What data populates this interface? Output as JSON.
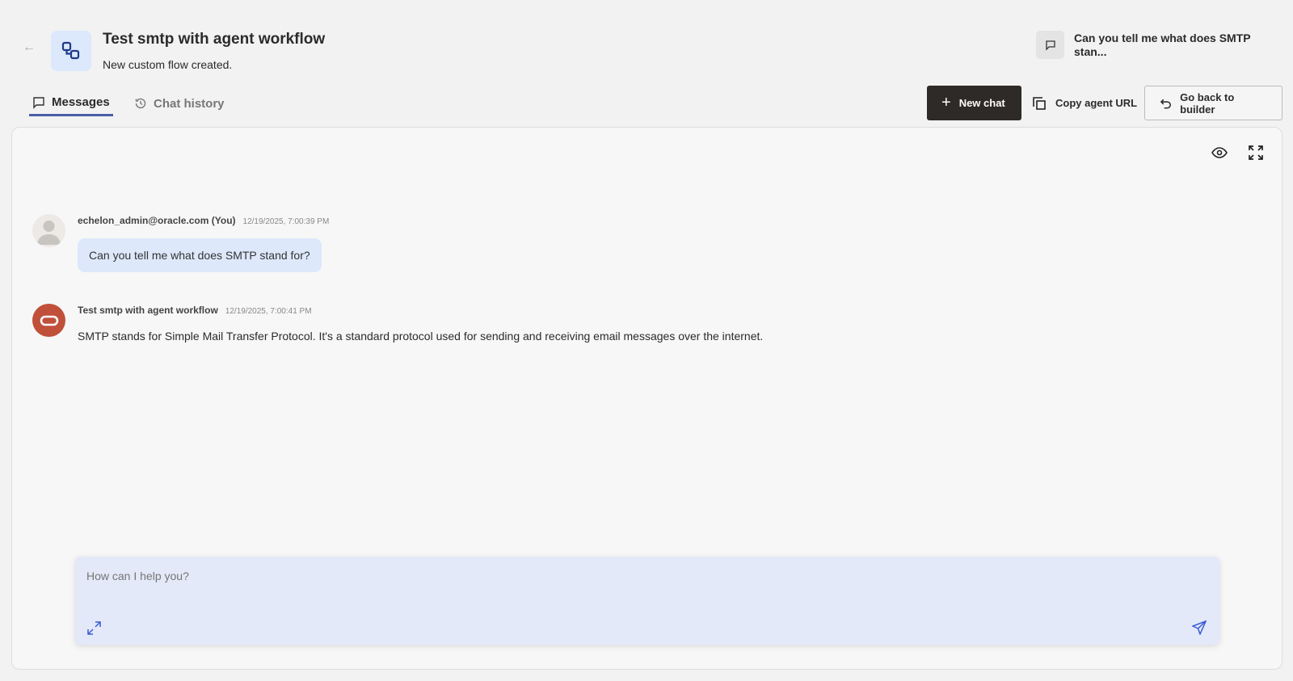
{
  "header": {
    "title": "Test smtp with agent workflow",
    "subtitle": "New custom flow created.",
    "recent_chat": "Can you tell me what does SMTP stan..."
  },
  "tabs": [
    {
      "label": "Messages"
    },
    {
      "label": "Chat history"
    }
  ],
  "actions": {
    "new_chat": "New chat",
    "copy_url": "Copy agent URL",
    "go_back": "Go back to builder"
  },
  "messages": [
    {
      "author": "echelon_admin@oracle.com (You)",
      "timestamp": "12/19/2025, 7:00:39 PM",
      "text": "Can you tell me what does SMTP stand for?"
    },
    {
      "author": "Test smtp with agent workflow",
      "timestamp": "12/19/2025, 7:00:41 PM",
      "text": "SMTP stands for Simple Mail Transfer Protocol. It's a standard protocol used for sending and receiving email messages over the internet."
    }
  ],
  "input": {
    "placeholder": "How can I help you?"
  },
  "colors": {
    "accent": "#4a5fa8",
    "bot_avatar": "#c0503a",
    "primary_button": "#2e2a27"
  }
}
